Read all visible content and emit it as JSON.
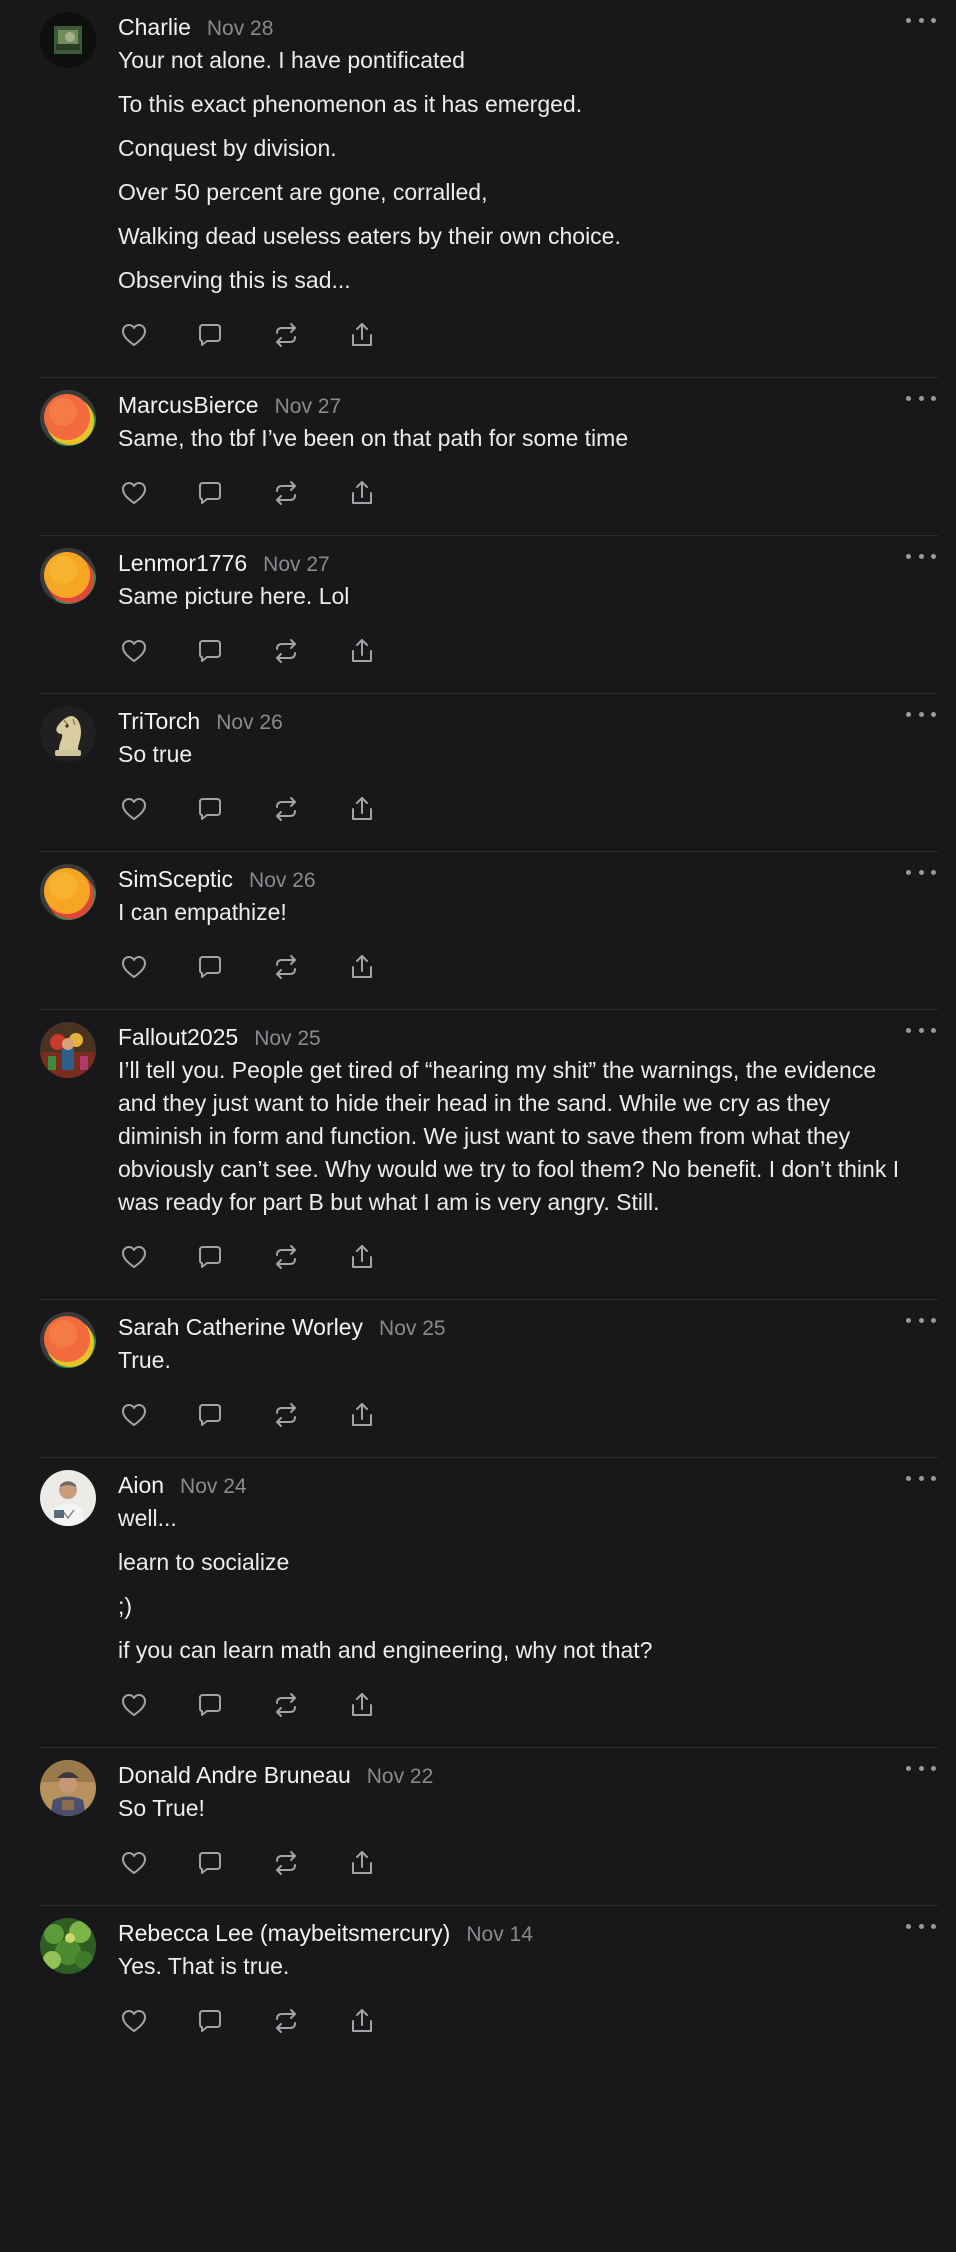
{
  "comments": [
    {
      "author": "Charlie",
      "date": "Nov 28",
      "avatar": "photo-dark-green",
      "paragraphs": [
        "Your not alone. I have pontificated",
        "To this exact phenomenon as it has emerged.",
        "Conquest by division.",
        "Over 50 percent are gone, corralled,",
        "Walking dead useless eaters by their own choice.",
        "Observing this is sad..."
      ]
    },
    {
      "author": "MarcusBierce",
      "date": "Nov 27",
      "avatar": "gradient-red",
      "paragraphs": [
        "Same, tho tbf I’ve been on that path for some time"
      ]
    },
    {
      "author": "Lenmor1776",
      "date": "Nov 27",
      "avatar": "gradient-orange",
      "paragraphs": [
        "Same picture here. Lol"
      ]
    },
    {
      "author": "TriTorch",
      "date": "Nov 26",
      "avatar": "chess-knight",
      "paragraphs": [
        "So true"
      ]
    },
    {
      "author": "SimSceptic",
      "date": "Nov 26",
      "avatar": "gradient-orange",
      "paragraphs": [
        "I can empathize!"
      ]
    },
    {
      "author": "Fallout2025",
      "date": "Nov 25",
      "avatar": "photo-colorful",
      "paragraphs": [
        "I’ll tell you. People get tired of “hearing my shit” the warnings, the evidence and they just want to hide their head in the sand. While we cry as they diminish in form and function. We just want to save them from what they obviously can’t see. Why would we try to fool them? No benefit. I don’t think I was ready for part B but what I am is very angry. Still."
      ]
    },
    {
      "author": "Sarah Catherine Worley",
      "date": "Nov 25",
      "avatar": "gradient-red",
      "paragraphs": [
        "True."
      ]
    },
    {
      "author": "Aion",
      "date": "Nov 24",
      "avatar": "photo-man-light",
      "paragraphs": [
        "well...",
        "learn to socialize",
        ";)",
        "if you can learn math and engineering, why not that?"
      ]
    },
    {
      "author": "Donald Andre Bruneau",
      "date": "Nov 22",
      "avatar": "photo-man-tan",
      "paragraphs": [
        "So True!"
      ]
    },
    {
      "author": "Rebecca Lee (maybeitsmercury)",
      "date": "Nov 14",
      "avatar": "photo-green",
      "paragraphs": [
        "Yes. That is true."
      ]
    }
  ],
  "icons": {
    "like": "heart-icon",
    "reply": "comment-icon",
    "restack": "restack-icon",
    "share": "share-icon",
    "more": "more-icon"
  },
  "colors": {
    "background": "#18181a",
    "text": "#ececec",
    "muted": "#8b8b8f",
    "divider": "#2c2c2f",
    "icon": "#a3a3a7"
  }
}
